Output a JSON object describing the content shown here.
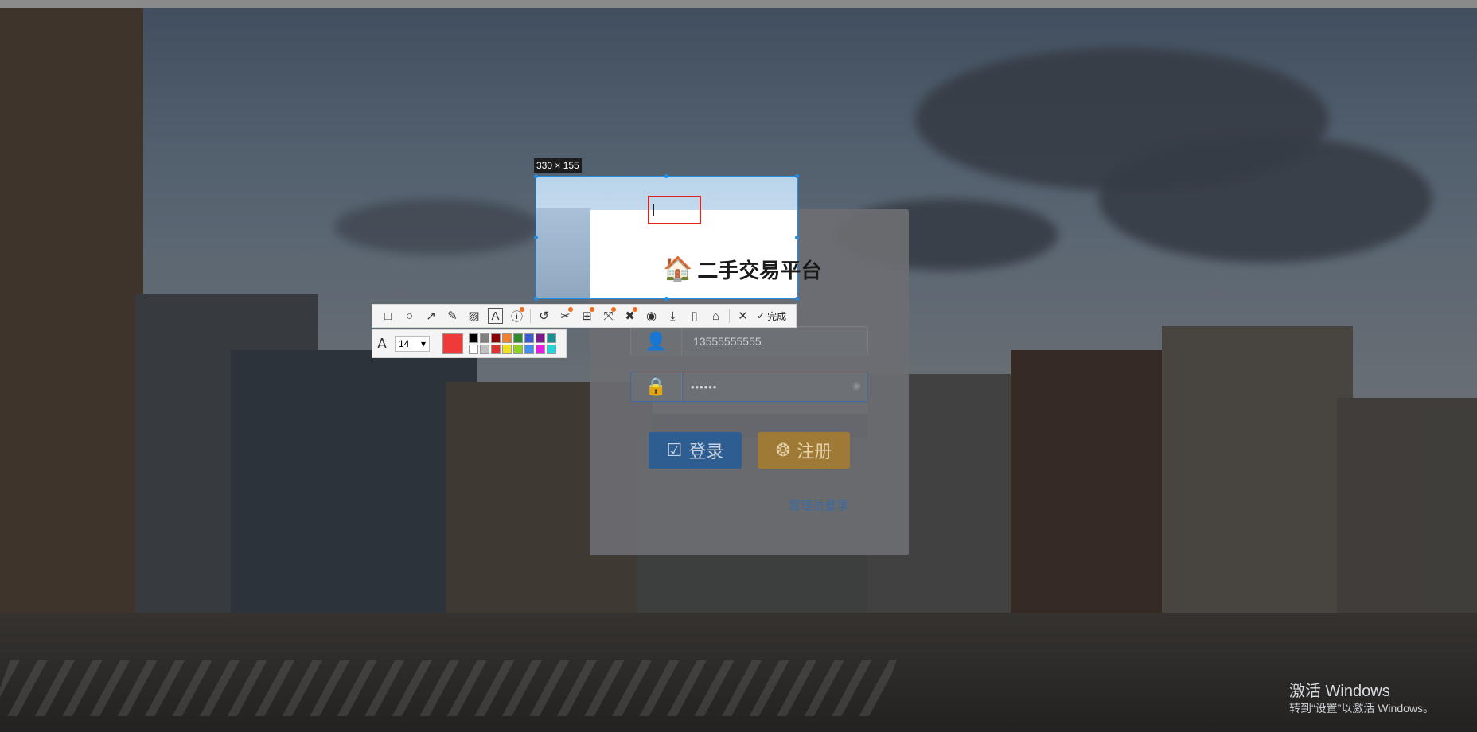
{
  "selection": {
    "size_label": "330 × 155"
  },
  "captured": {
    "title": "二手交易平台",
    "house_icon": "house-icon"
  },
  "login": {
    "phone_value": "13555555555",
    "password_value": "••••••",
    "login_button": "登录",
    "register_button": "注册",
    "admin_link": "管理员登录"
  },
  "toolbar": {
    "tools": [
      {
        "name": "rectangle-tool-icon",
        "glyph": "□"
      },
      {
        "name": "ellipse-tool-icon",
        "glyph": "○"
      },
      {
        "name": "arrow-tool-icon",
        "glyph": "↗"
      },
      {
        "name": "pencil-tool-icon",
        "glyph": "✎"
      },
      {
        "name": "mosaic-tool-icon",
        "glyph": "▨"
      },
      {
        "name": "text-tool-icon",
        "glyph": "A"
      },
      {
        "name": "number-tool-icon",
        "glyph": "ⓘ"
      },
      {
        "name": "undo-tool-icon",
        "glyph": "↺"
      },
      {
        "name": "scissors-tool-icon",
        "glyph": "✂"
      },
      {
        "name": "ocr-tool-icon",
        "glyph": "⊞"
      },
      {
        "name": "crop-tool-icon",
        "glyph": "⤧"
      },
      {
        "name": "pin-tool-icon",
        "glyph": "✖"
      },
      {
        "name": "record-tool-icon",
        "glyph": "◉"
      },
      {
        "name": "download-tool-icon",
        "glyph": "⤓"
      },
      {
        "name": "phone-tool-icon",
        "glyph": "▯"
      },
      {
        "name": "bookmark-tool-icon",
        "glyph": "⌂"
      }
    ],
    "close_glyph": "✕",
    "done_label": "完成",
    "font_size": "14"
  },
  "colors": {
    "current": "#f03a3a",
    "palette": [
      "#000000",
      "#808080",
      "#8b0000",
      "#f08030",
      "#2e8b2e",
      "#3a5bd0",
      "#7a1b8a",
      "#1a8f8f",
      "#ffffff",
      "#c0c0c0",
      "#e03030",
      "#f0e020",
      "#90d020",
      "#4090f0",
      "#e020e0",
      "#20d8d8"
    ]
  },
  "watermark": {
    "line1": "激活 Windows",
    "line2": "转到“设置”以激活 Windows。"
  }
}
